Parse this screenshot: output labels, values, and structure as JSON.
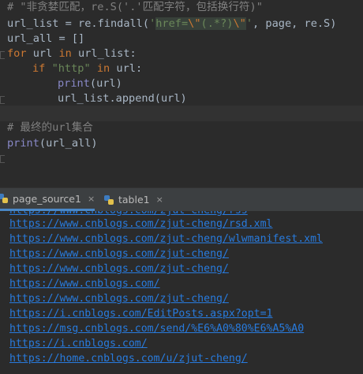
{
  "code": {
    "line1_comment": "# \"非贪婪匹配，re.S('.'匹配字符，包括换行符)\"",
    "line2_a": "url_list = re.findall(",
    "line2_q1": "'",
    "line2_s1": "href=",
    "line2_e1": "\\\"",
    "line2_rx": "(.*?)",
    "line2_e2": "\\\"",
    "line2_q2": "'",
    "line2_b": ", page, re.S)",
    "line3": "url_all = []",
    "line4_kw": "for",
    "line4_a": " url ",
    "line4_kw2": "in",
    "line4_b": " url_list:",
    "line5_kw": "if",
    "line5_str": "\"http\"",
    "line5_kw2": "in",
    "line5_b": " url:",
    "line6_fn": "print",
    "line6_b": "(url)",
    "line7": "url_list.append(url)",
    "line9_comment": "# 最终的url集合",
    "line10_fn": "print",
    "line10_b": "(url_all)"
  },
  "tabs": [
    {
      "label": "page_source1",
      "close": "×"
    },
    {
      "label": "table1",
      "close": "×"
    }
  ],
  "output_lines": [
    "https://www.cnblogs.com/zjut-cheng/rss",
    "https://www.cnblogs.com/zjut-cheng/rsd.xml",
    "https://www.cnblogs.com/zjut-cheng/wlwmanifest.xml",
    "https://www.cnblogs.com/zjut-cheng/",
    "https://www.cnblogs.com/zjut-cheng/",
    "https://www.cnblogs.com/",
    "https://www.cnblogs.com/zjut-cheng/",
    "https://i.cnblogs.com/EditPosts.aspx?opt=1",
    "https://msg.cnblogs.com/send/%E6%A0%80%E6%A5%A0",
    "https://i.cnblogs.com/",
    "https://home.cnblogs.com/u/zjut-cheng/"
  ],
  "colors": {
    "background": "#2b2b2b",
    "keyword": "#cc7832",
    "string": "#6a8759",
    "link": "#287bde",
    "comment": "#808080"
  }
}
